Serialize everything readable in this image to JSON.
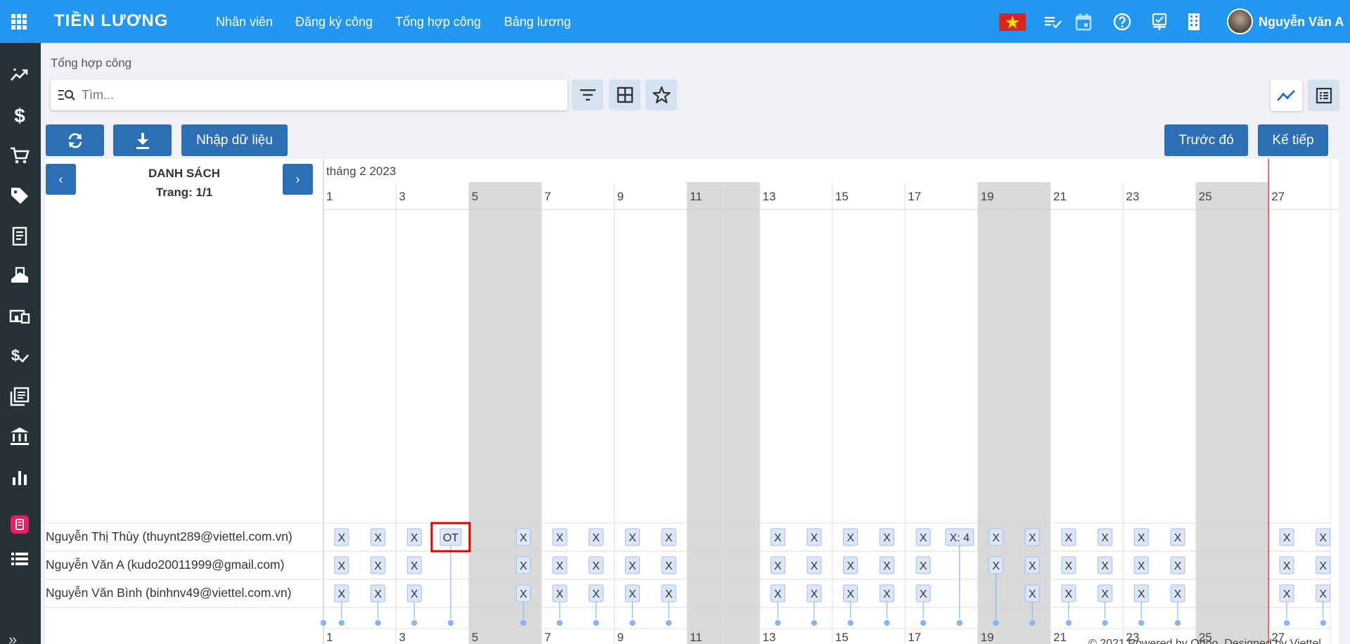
{
  "topbar": {
    "title": "TIỀN LƯƠNG",
    "nav": [
      "Nhân viên",
      "Đăng ký công",
      "Tổng hợp công",
      "Bảng lương"
    ],
    "icons": [
      "checklist-icon",
      "calendar-icon",
      "help-icon",
      "attendance-icon",
      "building-icon"
    ],
    "user_name": "Nguyễn Văn A",
    "accent": "#2196f3"
  },
  "sidebar": {
    "icons": [
      "trend-icon",
      "dollar-icon",
      "cart-icon",
      "tag-icon",
      "receipt-icon",
      "deposit-icon",
      "devices-icon",
      "payment-check-icon",
      "library-icon",
      "bank-icon",
      "bar-chart-icon",
      "app-icon",
      "list-icon",
      "expand-icon"
    ]
  },
  "breadcrumb": "Tổng hợp công",
  "search": {
    "placeholder": "Tìm..."
  },
  "actions": {
    "import_label": "Nhập dữ liệu",
    "prev_label": "Trước đó",
    "next_label": "Kế tiếp"
  },
  "list": {
    "title": "DANH SÁCH",
    "page": "Trang: 1/1",
    "prev": "‹",
    "next": "›"
  },
  "timeline": {
    "month_label": "tháng 2 2023",
    "days_shown": 28,
    "day_labels": [
      "1",
      "3",
      "5",
      "7",
      "9",
      "11",
      "13",
      "15",
      "17",
      "19",
      "21",
      "23",
      "25",
      "27"
    ],
    "weekend_days": [
      5,
      6,
      11,
      12,
      19,
      20,
      25,
      26
    ],
    "today": 27,
    "today_color": "#e53935",
    "employees": [
      {
        "name": "Nguyễn Thị Thùy (thuynt289@viettel.com.vn)",
        "entries": [
          {
            "day": 1,
            "label": "X"
          },
          {
            "day": 2,
            "label": "X"
          },
          {
            "day": 3,
            "label": "X"
          },
          {
            "day": 4,
            "label": "OT",
            "highlighted": true
          },
          {
            "day": 6,
            "label": "X"
          },
          {
            "day": 7,
            "label": "X"
          },
          {
            "day": 8,
            "label": "X"
          },
          {
            "day": 9,
            "label": "X"
          },
          {
            "day": 10,
            "label": "X"
          },
          {
            "day": 13,
            "label": "X"
          },
          {
            "day": 14,
            "label": "X"
          },
          {
            "day": 15,
            "label": "X"
          },
          {
            "day": 16,
            "label": "X"
          },
          {
            "day": 17,
            "label": "X"
          },
          {
            "day": 18,
            "label": "X: 4"
          },
          {
            "day": 19,
            "label": "X"
          },
          {
            "day": 20,
            "label": "X"
          },
          {
            "day": 21,
            "label": "X"
          },
          {
            "day": 22,
            "label": "X"
          },
          {
            "day": 23,
            "label": "X"
          },
          {
            "day": 24,
            "label": "X"
          },
          {
            "day": 27,
            "label": "X"
          },
          {
            "day": 28,
            "label": "X"
          }
        ]
      },
      {
        "name": "Nguyễn Văn A (kudo20011999@gmail.com)",
        "entries": [
          {
            "day": 1,
            "label": "X"
          },
          {
            "day": 2,
            "label": "X"
          },
          {
            "day": 3,
            "label": "X"
          },
          {
            "day": 6,
            "label": "X"
          },
          {
            "day": 7,
            "label": "X"
          },
          {
            "day": 8,
            "label": "X"
          },
          {
            "day": 9,
            "label": "X"
          },
          {
            "day": 10,
            "label": "X"
          },
          {
            "day": 13,
            "label": "X"
          },
          {
            "day": 14,
            "label": "X"
          },
          {
            "day": 15,
            "label": "X"
          },
          {
            "day": 16,
            "label": "X"
          },
          {
            "day": 17,
            "label": "X"
          },
          {
            "day": 19,
            "label": "X"
          },
          {
            "day": 20,
            "label": "X"
          },
          {
            "day": 21,
            "label": "X"
          },
          {
            "day": 22,
            "label": "X"
          },
          {
            "day": 23,
            "label": "X"
          },
          {
            "day": 24,
            "label": "X"
          },
          {
            "day": 27,
            "label": "X"
          },
          {
            "day": 28,
            "label": "X"
          }
        ]
      },
      {
        "name": "Nguyễn Văn Bình (binhnv49@viettel.com.vn)",
        "entries": [
          {
            "day": 1,
            "label": "X"
          },
          {
            "day": 2,
            "label": "X"
          },
          {
            "day": 3,
            "label": "X"
          },
          {
            "day": 6,
            "label": "X"
          },
          {
            "day": 7,
            "label": "X"
          },
          {
            "day": 8,
            "label": "X"
          },
          {
            "day": 9,
            "label": "X"
          },
          {
            "day": 10,
            "label": "X"
          },
          {
            "day": 13,
            "label": "X"
          },
          {
            "day": 14,
            "label": "X"
          },
          {
            "day": 15,
            "label": "X"
          },
          {
            "day": 16,
            "label": "X"
          },
          {
            "day": 17,
            "label": "X"
          },
          {
            "day": 20,
            "label": "X"
          },
          {
            "day": 21,
            "label": "X"
          },
          {
            "day": 22,
            "label": "X"
          },
          {
            "day": 23,
            "label": "X"
          },
          {
            "day": 24,
            "label": "X"
          },
          {
            "day": 27,
            "label": "X"
          },
          {
            "day": 28,
            "label": "X"
          }
        ]
      }
    ]
  },
  "footer": "© 2021 Powered by Odoo, Designed by Viettel"
}
